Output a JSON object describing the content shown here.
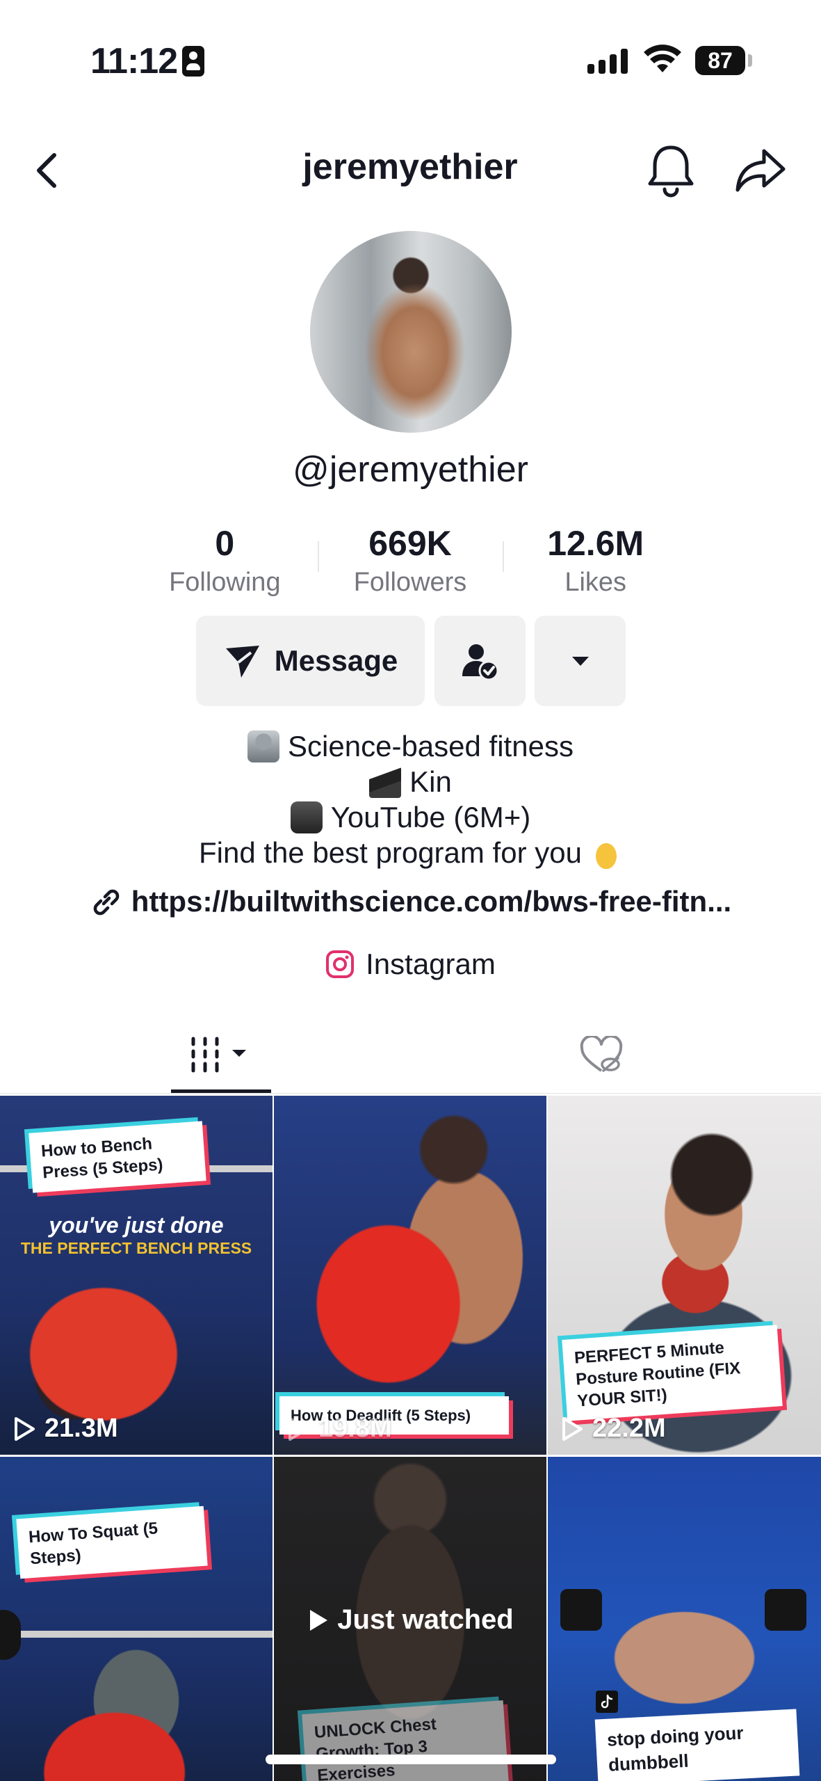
{
  "status_bar": {
    "time": "11:12",
    "battery": "87"
  },
  "header": {
    "title": "jeremyethier"
  },
  "profile": {
    "handle": "@jeremyethier",
    "stats": [
      {
        "value": "0",
        "label": "Following"
      },
      {
        "value": "669K",
        "label": "Followers"
      },
      {
        "value": "12.6M",
        "label": "Likes"
      }
    ],
    "message_label": "Message",
    "bio": [
      {
        "icon": "microscope-emoji",
        "text": "Science-based fitness"
      },
      {
        "icon": "graduation-cap-emoji",
        "text": "Kin"
      },
      {
        "icon": "movie-camera-emoji",
        "text": "YouTube (6M+)"
      },
      {
        "icon": "pointing-down-emoji",
        "text": "Find the best program for you"
      }
    ],
    "link": "https://builtwithscience.com/bws-free-fitn...",
    "instagram_label": "Instagram"
  },
  "colors": {
    "accent_cyan": "#3ad0e0",
    "accent_red": "#ee3b5b",
    "instagram": "#e1306c"
  },
  "videos": [
    {
      "tag": "How to Bench Press (5 Steps)",
      "overlay_line1": "you've just done",
      "overlay_line2": "THE PERFECT BENCH PRESS",
      "views": "21.3M"
    },
    {
      "tag": "How to Deadlift (5 Steps)",
      "views": "19.8M"
    },
    {
      "tag": "PERFECT 5 Minute Posture Routine (FIX YOUR SIT!)",
      "views": "22.2M"
    },
    {
      "tag": "How To Squat (5 Steps)"
    },
    {
      "tag": "UNLOCK Chest Growth: Top 3 Exercises",
      "status": "Just watched"
    },
    {
      "tag": "stop doing your dumbbell"
    }
  ]
}
